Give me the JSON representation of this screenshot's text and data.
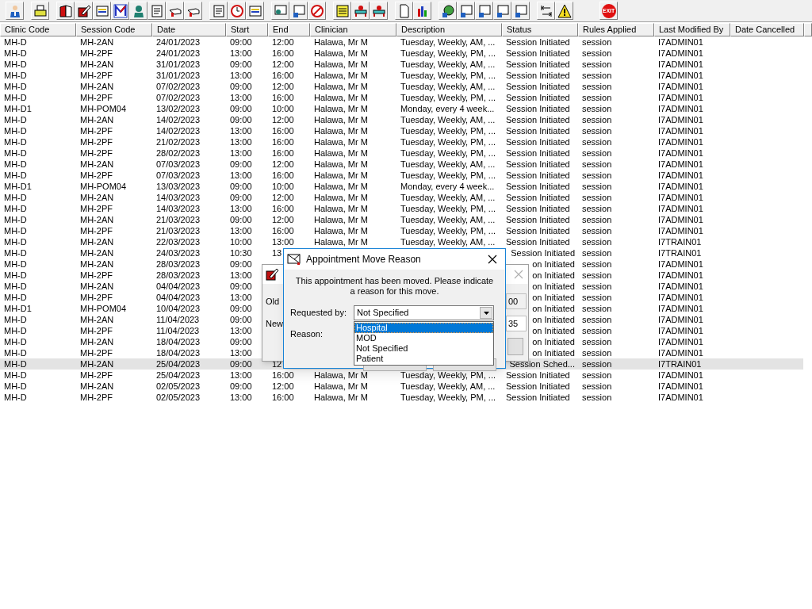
{
  "toolbar": {
    "exit_label": "EXIT"
  },
  "table": {
    "columns": [
      "Clinic Code",
      "Session Code",
      "Date",
      "Start",
      "End",
      "Clinician",
      "Description",
      "Status",
      "Rules Applied",
      "Last Modified By",
      "Date Cancelled"
    ],
    "rows": [
      {
        "selected": false,
        "cells": [
          "MH-D",
          "MH-2AN",
          "24/01/2023",
          "09:00",
          "12:00",
          "Halawa, Mr M",
          "Tuesday, Weekly, AM, ...",
          "Session Initiated",
          "session",
          "I7ADMIN01"
        ]
      },
      {
        "selected": false,
        "cells": [
          "MH-D",
          "MH-2PF",
          "24/01/2023",
          "13:00",
          "16:00",
          "Halawa, Mr M",
          "Tuesday, Weekly, PM, ...",
          "Session Initiated",
          "session",
          "I7ADMIN01"
        ]
      },
      {
        "selected": false,
        "cells": [
          "MH-D",
          "MH-2AN",
          "31/01/2023",
          "09:00",
          "12:00",
          "Halawa, Mr M",
          "Tuesday, Weekly, AM, ...",
          "Session Initiated",
          "session",
          "I7ADMIN01"
        ]
      },
      {
        "selected": false,
        "cells": [
          "MH-D",
          "MH-2PF",
          "31/01/2023",
          "13:00",
          "16:00",
          "Halawa, Mr M",
          "Tuesday, Weekly, PM, ...",
          "Session Initiated",
          "session",
          "I7ADMIN01"
        ]
      },
      {
        "selected": false,
        "cells": [
          "MH-D",
          "MH-2AN",
          "07/02/2023",
          "09:00",
          "12:00",
          "Halawa, Mr M",
          "Tuesday, Weekly, AM, ...",
          "Session Initiated",
          "session",
          "I7ADMIN01"
        ]
      },
      {
        "selected": false,
        "cells": [
          "MH-D",
          "MH-2PF",
          "07/02/2023",
          "13:00",
          "16:00",
          "Halawa, Mr M",
          "Tuesday, Weekly, PM, ...",
          "Session Initiated",
          "session",
          "I7ADMIN01"
        ]
      },
      {
        "selected": false,
        "cells": [
          "MH-D1",
          "MH-POM04",
          "13/02/2023",
          "09:00",
          "10:00",
          "Halawa, Mr M",
          "Monday, every 4 week...",
          "Session Initiated",
          "session",
          "I7ADMIN01"
        ]
      },
      {
        "selected": false,
        "cells": [
          "MH-D",
          "MH-2AN",
          "14/02/2023",
          "09:00",
          "12:00",
          "Halawa, Mr M",
          "Tuesday, Weekly, AM, ...",
          "Session Initiated",
          "session",
          "I7ADMIN01"
        ]
      },
      {
        "selected": false,
        "cells": [
          "MH-D",
          "MH-2PF",
          "14/02/2023",
          "13:00",
          "16:00",
          "Halawa, Mr M",
          "Tuesday, Weekly, PM, ...",
          "Session Initiated",
          "session",
          "I7ADMIN01"
        ]
      },
      {
        "selected": false,
        "cells": [
          "MH-D",
          "MH-2PF",
          "21/02/2023",
          "13:00",
          "16:00",
          "Halawa, Mr M",
          "Tuesday, Weekly, PM, ...",
          "Session Initiated",
          "session",
          "I7ADMIN01"
        ]
      },
      {
        "selected": false,
        "cells": [
          "MH-D",
          "MH-2PF",
          "28/02/2023",
          "13:00",
          "16:00",
          "Halawa, Mr M",
          "Tuesday, Weekly, PM, ...",
          "Session Initiated",
          "session",
          "I7ADMIN01"
        ]
      },
      {
        "selected": false,
        "cells": [
          "MH-D",
          "MH-2AN",
          "07/03/2023",
          "09:00",
          "12:00",
          "Halawa, Mr M",
          "Tuesday, Weekly, AM, ...",
          "Session Initiated",
          "session",
          "I7ADMIN01"
        ]
      },
      {
        "selected": false,
        "cells": [
          "MH-D",
          "MH-2PF",
          "07/03/2023",
          "13:00",
          "16:00",
          "Halawa, Mr M",
          "Tuesday, Weekly, PM, ...",
          "Session Initiated",
          "session",
          "I7ADMIN01"
        ]
      },
      {
        "selected": false,
        "cells": [
          "MH-D1",
          "MH-POM04",
          "13/03/2023",
          "09:00",
          "10:00",
          "Halawa, Mr M",
          "Monday, every 4 week...",
          "Session Initiated",
          "session",
          "I7ADMIN01"
        ]
      },
      {
        "selected": false,
        "cells": [
          "MH-D",
          "MH-2AN",
          "14/03/2023",
          "09:00",
          "12:00",
          "Halawa, Mr M",
          "Tuesday, Weekly, AM, ...",
          "Session Initiated",
          "session",
          "I7ADMIN01"
        ]
      },
      {
        "selected": false,
        "cells": [
          "MH-D",
          "MH-2PF",
          "14/03/2023",
          "13:00",
          "16:00",
          "Halawa, Mr M",
          "Tuesday, Weekly, PM, ...",
          "Session Initiated",
          "session",
          "I7ADMIN01"
        ]
      },
      {
        "selected": false,
        "cells": [
          "MH-D",
          "MH-2AN",
          "21/03/2023",
          "09:00",
          "12:00",
          "Halawa, Mr M",
          "Tuesday, Weekly, AM, ...",
          "Session Initiated",
          "session",
          "I7ADMIN01"
        ]
      },
      {
        "selected": false,
        "cells": [
          "MH-D",
          "MH-2PF",
          "21/03/2023",
          "13:00",
          "16:00",
          "Halawa, Mr M",
          "Tuesday, Weekly, PM, ...",
          "Session Initiated",
          "session",
          "I7ADMIN01"
        ]
      },
      {
        "selected": false,
        "cells": [
          "MH-D",
          "MH-2AN",
          "22/03/2023",
          "10:00",
          "13:00",
          "Halawa, Mr M",
          "Tuesday, Weekly, AM, ...",
          "Session Initiated",
          "session",
          "I7TRAIN01"
        ]
      },
      {
        "selected": false,
        "cells": [
          "MH-D",
          "MH-2AN",
          "24/03/2023",
          "10:30",
          "13",
          null,
          null,
          "Session Initiated",
          "session",
          "I7TRAIN01"
        ]
      },
      {
        "selected": false,
        "cells": [
          "MH-D",
          "MH-2AN",
          "28/03/2023",
          "09:00",
          null,
          null,
          null,
          "on Initiated",
          "session",
          "I7ADMIN01"
        ]
      },
      {
        "selected": false,
        "cells": [
          "MH-D",
          "MH-2PF",
          "28/03/2023",
          "13:00",
          null,
          null,
          null,
          "on Initiated",
          "session",
          "I7ADMIN01"
        ]
      },
      {
        "selected": false,
        "cells": [
          "MH-D",
          "MH-2AN",
          "04/04/2023",
          "09:00",
          null,
          null,
          null,
          "on Initiated",
          "session",
          "I7ADMIN01"
        ]
      },
      {
        "selected": false,
        "cells": [
          "MH-D",
          "MH-2PF",
          "04/04/2023",
          "13:00",
          null,
          null,
          null,
          "on Initiated",
          "session",
          "I7ADMIN01"
        ]
      },
      {
        "selected": false,
        "cells": [
          "MH-D1",
          "MH-POM04",
          "10/04/2023",
          "09:00",
          null,
          null,
          null,
          "on Initiated",
          "session",
          "I7ADMIN01"
        ]
      },
      {
        "selected": false,
        "cells": [
          "MH-D",
          "MH-2AN",
          "11/04/2023",
          "09:00",
          null,
          null,
          null,
          "on Initiated",
          "session",
          "I7ADMIN01"
        ]
      },
      {
        "selected": false,
        "cells": [
          "MH-D",
          "MH-2PF",
          "11/04/2023",
          "13:00",
          null,
          null,
          null,
          "on Initiated",
          "session",
          "I7ADMIN01"
        ]
      },
      {
        "selected": false,
        "cells": [
          "MH-D",
          "MH-2AN",
          "18/04/2023",
          "09:00",
          null,
          null,
          null,
          "on Initiated",
          "session",
          "I7ADMIN01"
        ]
      },
      {
        "selected": false,
        "cells": [
          "MH-D",
          "MH-2PF",
          "18/04/2023",
          "13:00",
          null,
          null,
          null,
          "on Initiated",
          "session",
          "I7ADMIN01"
        ]
      },
      {
        "selected": true,
        "cells": [
          "MH-D",
          "MH-2AN",
          "25/04/2023",
          "09:00",
          "12",
          null,
          null,
          "Session Sched...",
          "session",
          "I7TRAIN01"
        ]
      },
      {
        "selected": false,
        "cells": [
          "MH-D",
          "MH-2PF",
          "25/04/2023",
          "13:00",
          "16:00",
          "Halawa, Mr M",
          "Tuesday, Weekly, PM, ...",
          "Session Initiated",
          "session",
          "I7ADMIN01"
        ]
      },
      {
        "selected": false,
        "cells": [
          "MH-D",
          "MH-2AN",
          "02/05/2023",
          "09:00",
          "12:00",
          "Halawa, Mr M",
          "Tuesday, Weekly, AM, ...",
          "Session Initiated",
          "session",
          "I7ADMIN01"
        ]
      },
      {
        "selected": false,
        "cells": [
          "MH-D",
          "MH-2PF",
          "02/05/2023",
          "13:00",
          "16:00",
          "Halawa, Mr M",
          "Tuesday, Weekly, PM, ...",
          "Session Initiated",
          "session",
          "I7ADMIN01"
        ]
      }
    ]
  },
  "back_dialog": {
    "labels": [
      "Old",
      "New"
    ],
    "fields": [
      "00",
      "35"
    ]
  },
  "move_reason_dialog": {
    "title": "Appointment Move Reason",
    "message": "This appointment has been moved. Please indicate a reason for this move.",
    "requested_by_label": "Requested by:",
    "requested_by_value": "Not Specified",
    "reason_label": "Reason:",
    "options": [
      {
        "label": "Hospital",
        "selected": true
      },
      {
        "label": "MOD",
        "selected": false
      },
      {
        "label": "Not Specified",
        "selected": false
      },
      {
        "label": "Patient",
        "selected": false
      }
    ]
  }
}
